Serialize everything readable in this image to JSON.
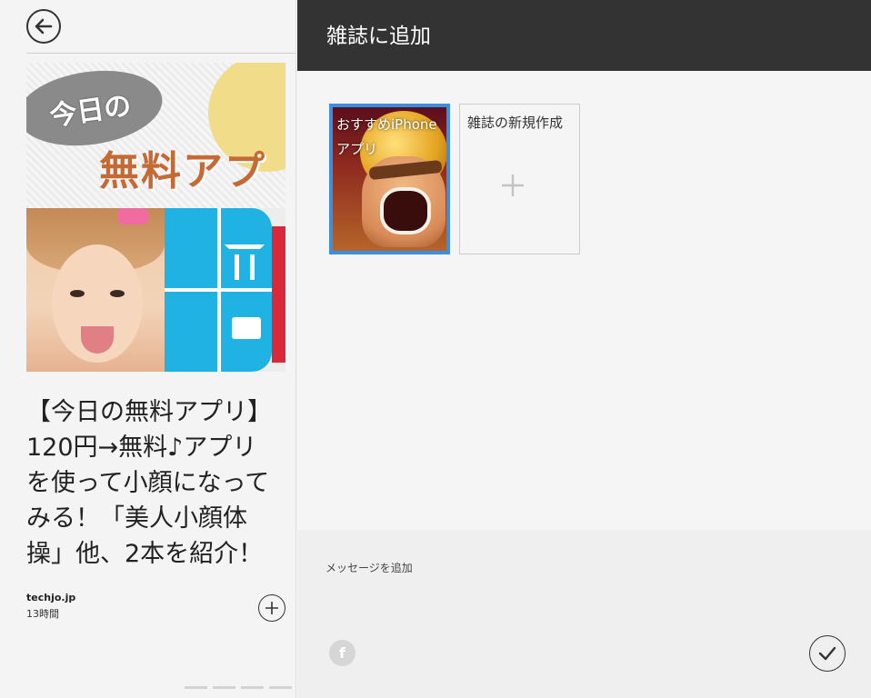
{
  "article": {
    "back_icon": "arrow-left-icon",
    "hero_image": {
      "bubble_text": "今日の",
      "band_text": "無料アプ"
    },
    "title": "【今日の無料アプリ】120円→無料♪アプリを使って小顔になってみる！「美人小顔体操」他、2本を紹介！",
    "source": "techjo.jp",
    "time": "13時間",
    "add_icon": "plus-circle-icon"
  },
  "panel": {
    "title": "雑誌に追加",
    "header_color": "#333333",
    "magazines": [
      {
        "label": "おすすめiPhoneアプリ",
        "selected": true,
        "selection_color": "#3c8fe0"
      }
    ],
    "new_magazine": {
      "label": "雑誌の新規作成",
      "icon": "plus-icon"
    },
    "message": {
      "placeholder": "メッセージを追加",
      "value": ""
    },
    "facebook_icon": "facebook-icon",
    "confirm_icon": "checkmark-icon"
  }
}
